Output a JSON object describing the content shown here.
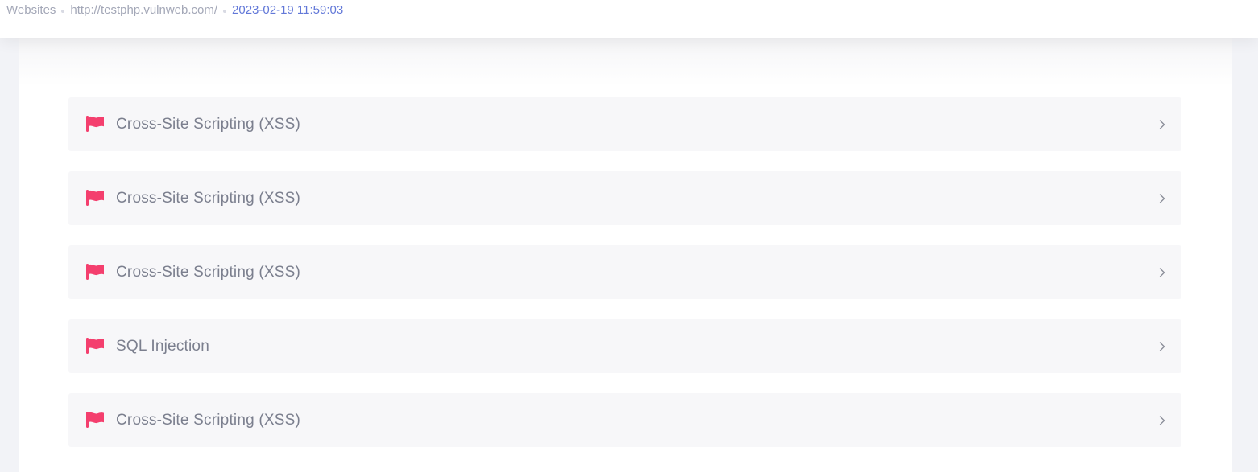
{
  "breadcrumb": {
    "section": "Websites",
    "target": "http://testphp.vulnweb.com/",
    "scan_time": "2023-02-19 11:59:03"
  },
  "vulnerabilities": [
    {
      "title": "Cross-Site Scripting (XSS)",
      "icon": "flag-icon"
    },
    {
      "title": "Cross-Site Scripting (XSS)",
      "icon": "flag-icon"
    },
    {
      "title": "Cross-Site Scripting (XSS)",
      "icon": "flag-icon"
    },
    {
      "title": "SQL Injection",
      "icon": "flag-icon"
    },
    {
      "title": "Cross-Site Scripting (XSS)",
      "icon": "flag-icon"
    }
  ],
  "colors": {
    "flag": "#f43f6e",
    "current_crumb": "#6278d8",
    "muted_text": "#a3a7b7",
    "item_text": "#7b7f8e",
    "item_bg": "#f7f7f9"
  }
}
